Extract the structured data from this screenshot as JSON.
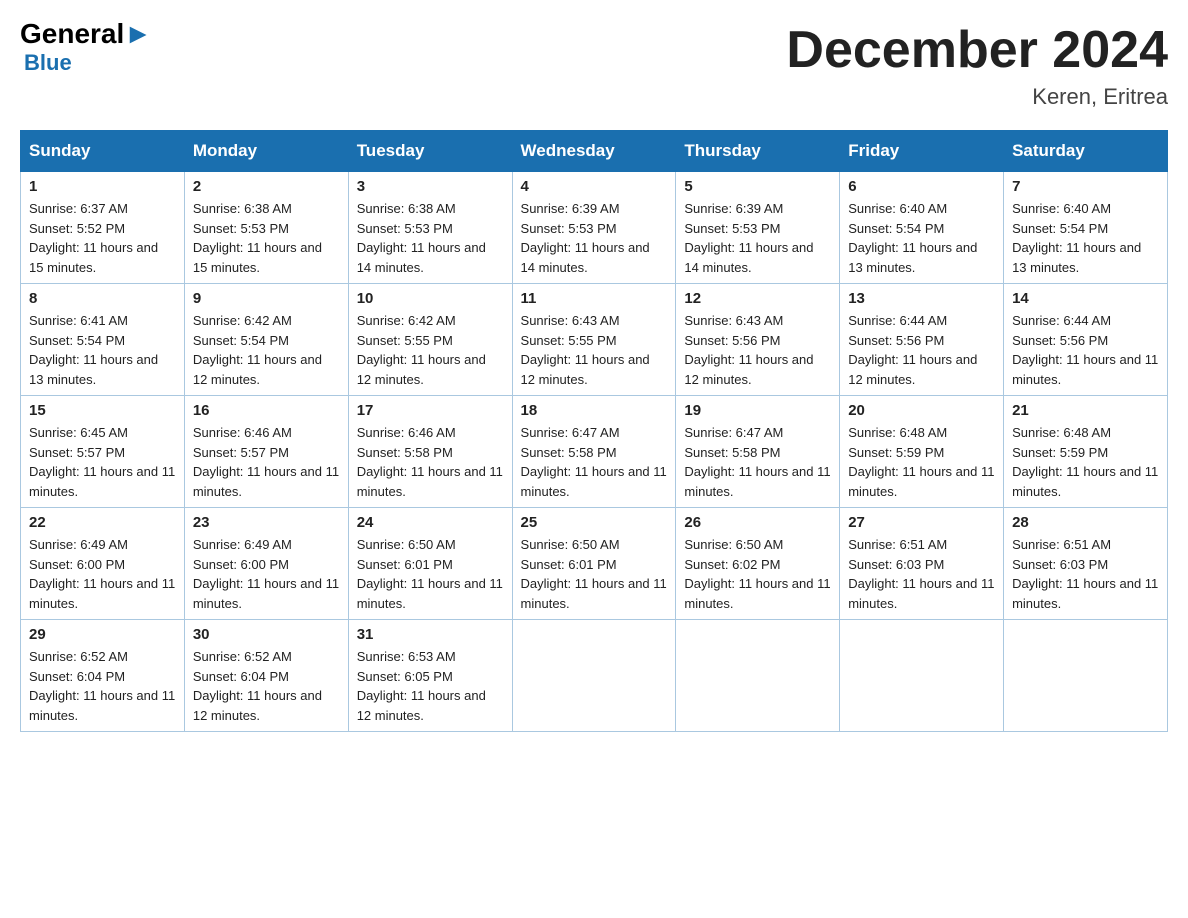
{
  "header": {
    "logo_general": "General",
    "logo_blue": "Blue",
    "month_title": "December 2024",
    "location": "Keren, Eritrea"
  },
  "weekdays": [
    "Sunday",
    "Monday",
    "Tuesday",
    "Wednesday",
    "Thursday",
    "Friday",
    "Saturday"
  ],
  "weeks": [
    [
      {
        "day": "1",
        "sunrise": "6:37 AM",
        "sunset": "5:52 PM",
        "daylight": "11 hours and 15 minutes."
      },
      {
        "day": "2",
        "sunrise": "6:38 AM",
        "sunset": "5:53 PM",
        "daylight": "11 hours and 15 minutes."
      },
      {
        "day": "3",
        "sunrise": "6:38 AM",
        "sunset": "5:53 PM",
        "daylight": "11 hours and 14 minutes."
      },
      {
        "day": "4",
        "sunrise": "6:39 AM",
        "sunset": "5:53 PM",
        "daylight": "11 hours and 14 minutes."
      },
      {
        "day": "5",
        "sunrise": "6:39 AM",
        "sunset": "5:53 PM",
        "daylight": "11 hours and 14 minutes."
      },
      {
        "day": "6",
        "sunrise": "6:40 AM",
        "sunset": "5:54 PM",
        "daylight": "11 hours and 13 minutes."
      },
      {
        "day": "7",
        "sunrise": "6:40 AM",
        "sunset": "5:54 PM",
        "daylight": "11 hours and 13 minutes."
      }
    ],
    [
      {
        "day": "8",
        "sunrise": "6:41 AM",
        "sunset": "5:54 PM",
        "daylight": "11 hours and 13 minutes."
      },
      {
        "day": "9",
        "sunrise": "6:42 AM",
        "sunset": "5:54 PM",
        "daylight": "11 hours and 12 minutes."
      },
      {
        "day": "10",
        "sunrise": "6:42 AM",
        "sunset": "5:55 PM",
        "daylight": "11 hours and 12 minutes."
      },
      {
        "day": "11",
        "sunrise": "6:43 AM",
        "sunset": "5:55 PM",
        "daylight": "11 hours and 12 minutes."
      },
      {
        "day": "12",
        "sunrise": "6:43 AM",
        "sunset": "5:56 PM",
        "daylight": "11 hours and 12 minutes."
      },
      {
        "day": "13",
        "sunrise": "6:44 AM",
        "sunset": "5:56 PM",
        "daylight": "11 hours and 12 minutes."
      },
      {
        "day": "14",
        "sunrise": "6:44 AM",
        "sunset": "5:56 PM",
        "daylight": "11 hours and 11 minutes."
      }
    ],
    [
      {
        "day": "15",
        "sunrise": "6:45 AM",
        "sunset": "5:57 PM",
        "daylight": "11 hours and 11 minutes."
      },
      {
        "day": "16",
        "sunrise": "6:46 AM",
        "sunset": "5:57 PM",
        "daylight": "11 hours and 11 minutes."
      },
      {
        "day": "17",
        "sunrise": "6:46 AM",
        "sunset": "5:58 PM",
        "daylight": "11 hours and 11 minutes."
      },
      {
        "day": "18",
        "sunrise": "6:47 AM",
        "sunset": "5:58 PM",
        "daylight": "11 hours and 11 minutes."
      },
      {
        "day": "19",
        "sunrise": "6:47 AM",
        "sunset": "5:58 PM",
        "daylight": "11 hours and 11 minutes."
      },
      {
        "day": "20",
        "sunrise": "6:48 AM",
        "sunset": "5:59 PM",
        "daylight": "11 hours and 11 minutes."
      },
      {
        "day": "21",
        "sunrise": "6:48 AM",
        "sunset": "5:59 PM",
        "daylight": "11 hours and 11 minutes."
      }
    ],
    [
      {
        "day": "22",
        "sunrise": "6:49 AM",
        "sunset": "6:00 PM",
        "daylight": "11 hours and 11 minutes."
      },
      {
        "day": "23",
        "sunrise": "6:49 AM",
        "sunset": "6:00 PM",
        "daylight": "11 hours and 11 minutes."
      },
      {
        "day": "24",
        "sunrise": "6:50 AM",
        "sunset": "6:01 PM",
        "daylight": "11 hours and 11 minutes."
      },
      {
        "day": "25",
        "sunrise": "6:50 AM",
        "sunset": "6:01 PM",
        "daylight": "11 hours and 11 minutes."
      },
      {
        "day": "26",
        "sunrise": "6:50 AM",
        "sunset": "6:02 PM",
        "daylight": "11 hours and 11 minutes."
      },
      {
        "day": "27",
        "sunrise": "6:51 AM",
        "sunset": "6:03 PM",
        "daylight": "11 hours and 11 minutes."
      },
      {
        "day": "28",
        "sunrise": "6:51 AM",
        "sunset": "6:03 PM",
        "daylight": "11 hours and 11 minutes."
      }
    ],
    [
      {
        "day": "29",
        "sunrise": "6:52 AM",
        "sunset": "6:04 PM",
        "daylight": "11 hours and 11 minutes."
      },
      {
        "day": "30",
        "sunrise": "6:52 AM",
        "sunset": "6:04 PM",
        "daylight": "11 hours and 12 minutes."
      },
      {
        "day": "31",
        "sunrise": "6:53 AM",
        "sunset": "6:05 PM",
        "daylight": "11 hours and 12 minutes."
      },
      null,
      null,
      null,
      null
    ]
  ]
}
